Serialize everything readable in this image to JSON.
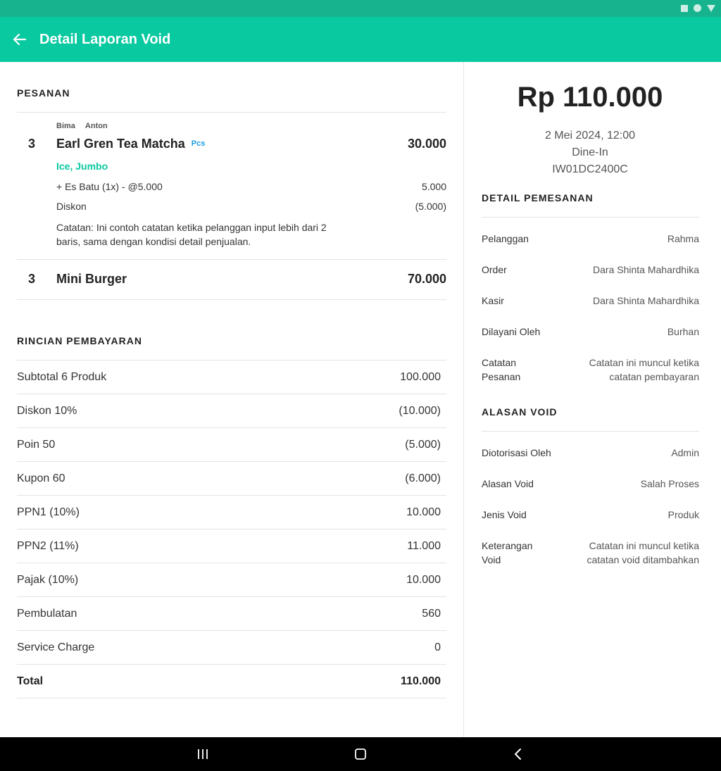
{
  "app": {
    "title": "Detail Laporan Void"
  },
  "order": {
    "section_title": "PESANAN",
    "items": [
      {
        "staff": [
          "Bima",
          "Anton"
        ],
        "qty": "3",
        "name": "Earl Gren Tea Matcha",
        "unit": "Pcs",
        "price": "30.000",
        "variant": "Ice, Jumbo",
        "addon_label": "+ Es Batu (1x) - @5.000",
        "addon_value": "5.000",
        "discount_label": "Diskon",
        "discount_value": "(5.000)",
        "note": "Catatan: Ini contoh catatan ketika pelanggan input lebih dari 2 baris, sama dengan kondisi detail penjualan."
      },
      {
        "qty": "3",
        "name": "Mini Burger",
        "price": "70.000"
      }
    ]
  },
  "payment": {
    "section_title": "RINCIAN PEMBAYARAN",
    "rows": [
      {
        "label": "Subtotal 6 Produk",
        "value": "100.000"
      },
      {
        "label": "Diskon 10%",
        "value": "(10.000)"
      },
      {
        "label": "Poin 50",
        "value": "(5.000)"
      },
      {
        "label": "Kupon 60",
        "value": "(6.000)"
      },
      {
        "label": "PPN1 (10%)",
        "value": "10.000"
      },
      {
        "label": "PPN2 (11%)",
        "value": "11.000"
      },
      {
        "label": "Pajak (10%)",
        "value": "10.000"
      },
      {
        "label": "Pembulatan",
        "value": "560"
      },
      {
        "label": "Service Charge",
        "value": "0"
      },
      {
        "label": "Total",
        "value": "110.000"
      }
    ]
  },
  "summary": {
    "total": "Rp 110.000",
    "date": "2 Mei 2024, 12:00",
    "type": "Dine-In",
    "code": "IW01DC2400C"
  },
  "order_detail": {
    "section_title": "DETAIL PEMESANAN",
    "rows": [
      {
        "label": "Pelanggan",
        "value": "Rahma"
      },
      {
        "label": "Order",
        "value": "Dara Shinta Mahardhika"
      },
      {
        "label": "Kasir",
        "value": "Dara Shinta Mahardhika"
      },
      {
        "label": "Dilayani Oleh",
        "value": "Burhan"
      },
      {
        "label": "Catatan Pesanan",
        "value": "Catatan ini muncul ketika catatan pembayaran"
      }
    ]
  },
  "void_reason": {
    "section_title": "ALASAN VOID",
    "rows": [
      {
        "label": "Diotorisasi Oleh",
        "value": "Admin"
      },
      {
        "label": "Alasan Void",
        "value": "Salah Proses"
      },
      {
        "label": "Jenis Void",
        "value": "Produk"
      },
      {
        "label": "Keterangan Void",
        "value": "Catatan ini muncul ketika catatan void ditambahkan"
      }
    ]
  },
  "icons": {
    "back": "arrow-left-icon",
    "nav_recents": "recents-icon",
    "nav_home": "home-icon",
    "nav_back": "chevron-left-icon"
  },
  "colors": {
    "primary": "#08c9a0",
    "statusbar": "#17b38e",
    "accent_unit": "#1a9ee0"
  }
}
